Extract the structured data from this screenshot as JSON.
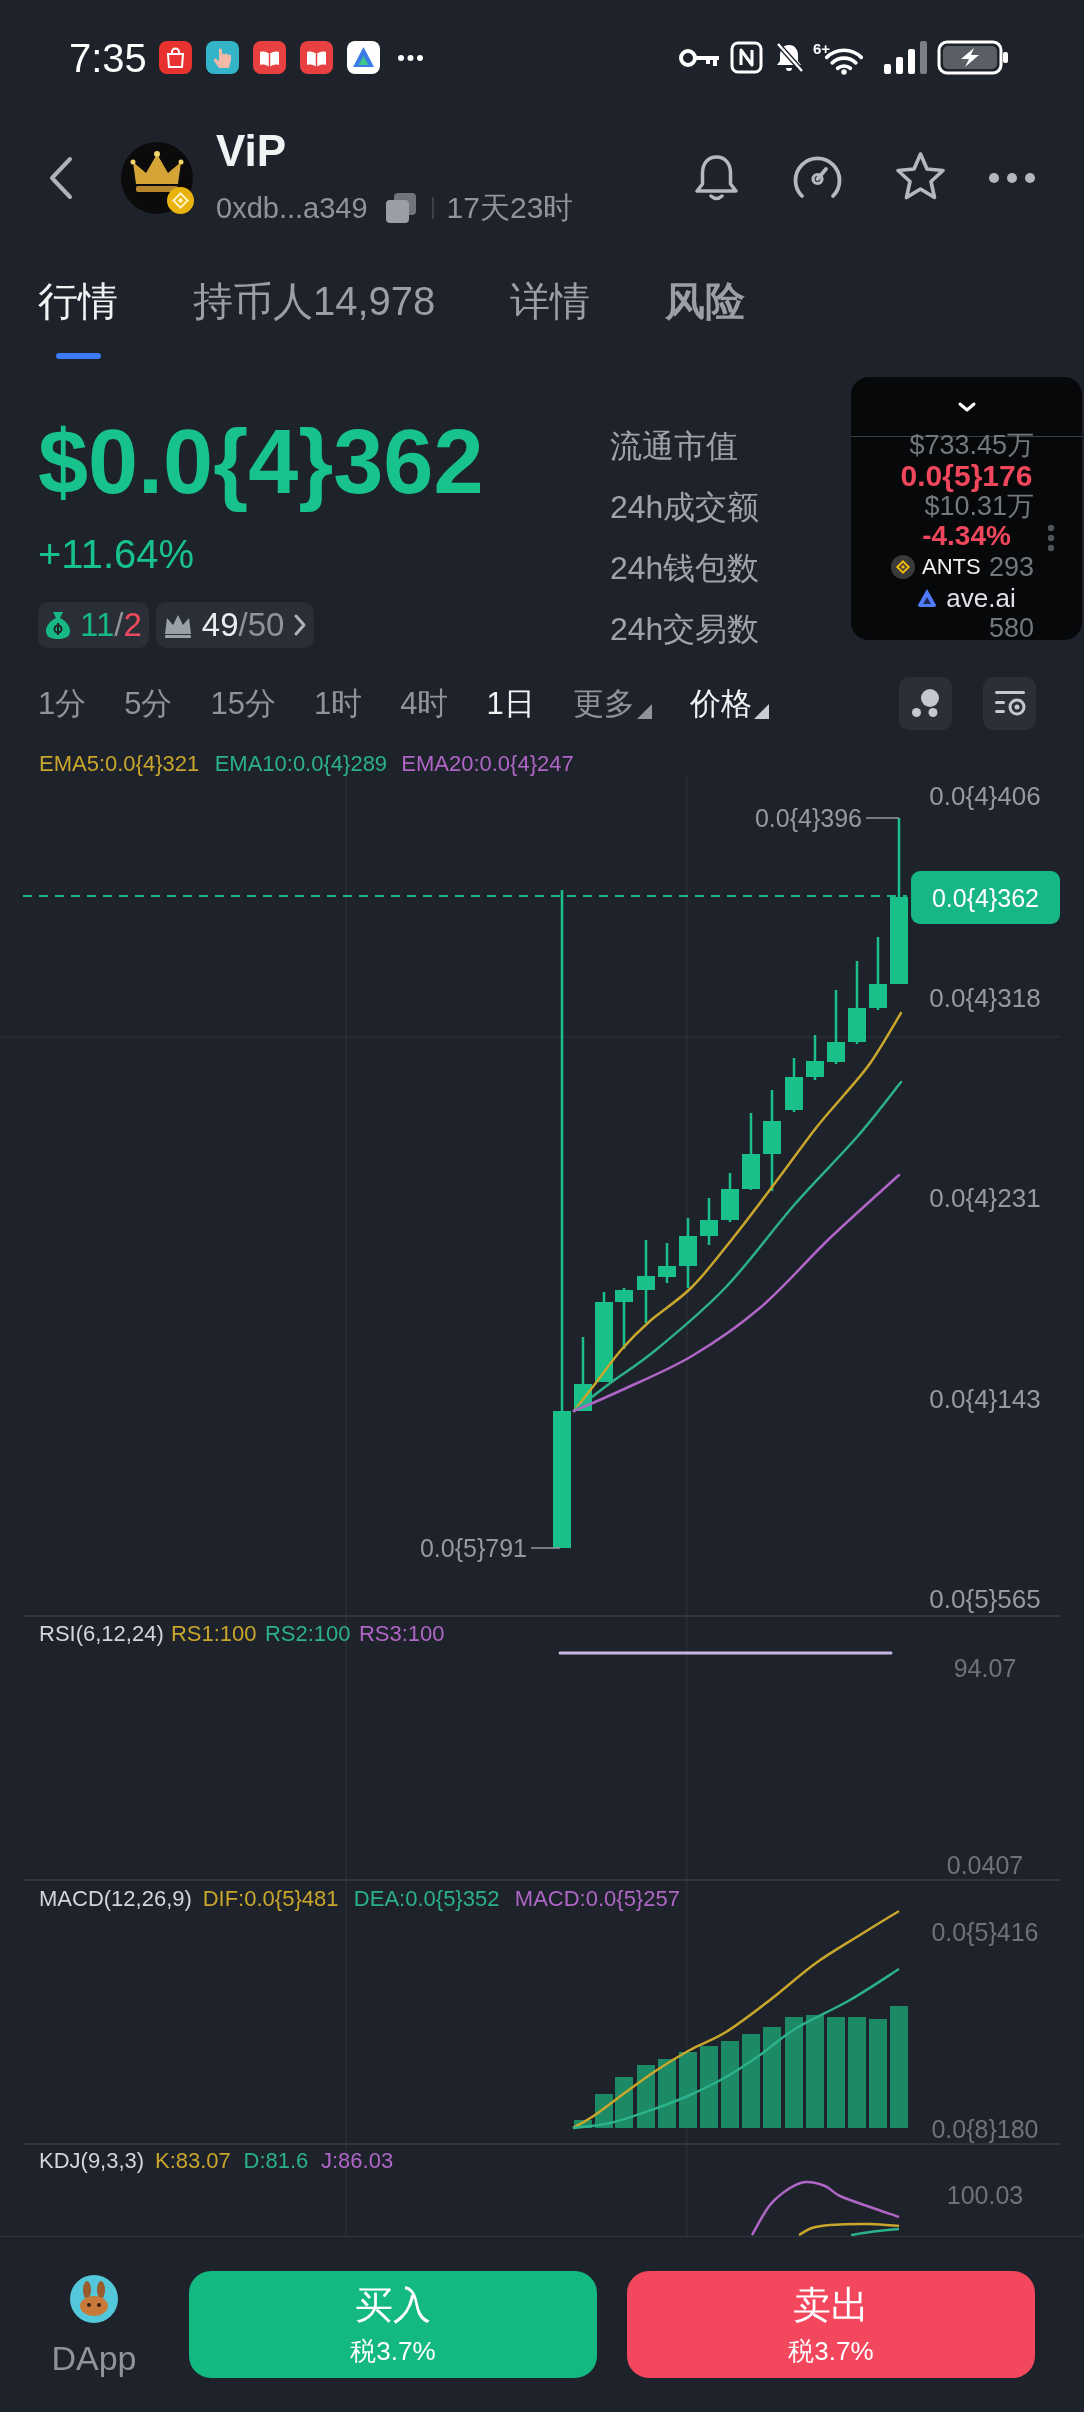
{
  "status_bar": {
    "time": "7:35",
    "wifi_badge": "6+"
  },
  "header": {
    "title": "ViP",
    "address": "0xdb...a349",
    "age": "17天23时"
  },
  "tabs": [
    {
      "label": "行情",
      "selected": true,
      "emphasized": false
    },
    {
      "label": "持币人14,978",
      "selected": false,
      "emphasized": false
    },
    {
      "label": "详情",
      "selected": false,
      "emphasized": false
    },
    {
      "label": "风险",
      "selected": false,
      "emphasized": true
    }
  ],
  "price": {
    "value": "$0.0{4}362",
    "change": "+11.64%",
    "negative": false,
    "badges": [
      {
        "kind": "money",
        "segments": [
          {
            "text": "11",
            "color": "#18b884"
          },
          {
            "text": "/",
            "color": "#8e939c"
          },
          {
            "text": "2",
            "color": "#f04a5e"
          }
        ],
        "chevron": false
      },
      {
        "kind": "top",
        "segments": [
          {
            "text": "49",
            "color": "#eceef1"
          },
          {
            "text": "/50",
            "color": "#8e939c"
          }
        ],
        "chevron": true
      }
    ]
  },
  "stats": [
    {
      "label": "流通市值",
      "value": "$733.45万"
    },
    {
      "label": "24h成交额",
      "value": "$10.31万"
    },
    {
      "label": "24h钱包数",
      "value": "293"
    },
    {
      "label": "24h交易数",
      "value": "580"
    }
  ],
  "floating_widget": {
    "price": "0.0{5}176",
    "change": "-4.34%",
    "negative": true,
    "token": "ANTS",
    "site": "ave.ai"
  },
  "chart_toolbar": {
    "timeframes": [
      {
        "label": "1分",
        "selected": false
      },
      {
        "label": "5分",
        "selected": false
      },
      {
        "label": "15分",
        "selected": false
      },
      {
        "label": "1时",
        "selected": false
      },
      {
        "label": "4时",
        "selected": false
      },
      {
        "label": "1日",
        "selected": true
      }
    ],
    "menus": [
      {
        "label": "更多",
        "active": false
      },
      {
        "label": "价格",
        "active": true
      }
    ]
  },
  "main_chart": {
    "legend": [
      {
        "label": "EMA5:0.0{4}321",
        "color": "#c9a62c"
      },
      {
        "label": "EMA10:0.0{4}289",
        "color": "#2bb18b"
      },
      {
        "label": "EMA20:0.0{4}247",
        "color": "#b066c6"
      }
    ],
    "y_labels": [
      "0.0{4}406",
      "0.0{4}318",
      "0.0{4}231",
      "0.0{4}143",
      "0.0{5}565"
    ],
    "current_price": "0.0{4}362",
    "high_label": "0.0{4}396",
    "low_label": "0.0{5}791"
  },
  "rsi": {
    "legend": [
      {
        "label": "RSI(6,12,24)",
        "color": "#d3d6db"
      },
      {
        "label": "RS1:100",
        "color": "#c9a62c"
      },
      {
        "label": "RS2:100",
        "color": "#2bb18b"
      },
      {
        "label": "RS3:100",
        "color": "#b066c6"
      }
    ],
    "y_labels": [
      "94.07",
      "0.0407"
    ]
  },
  "macd": {
    "legend": [
      {
        "label": "MACD(12,26,9)",
        "color": "#d3d6db"
      },
      {
        "label": "DIF:0.0{5}481",
        "color": "#c9a62c"
      },
      {
        "label": "DEA:0.0{5}352",
        "color": "#2bb18b"
      },
      {
        "label": "MACD:0.0{5}257",
        "color": "#b066c6"
      }
    ],
    "y_labels": [
      "0.0{5}416",
      "0.0{8}180"
    ]
  },
  "kdj": {
    "legend": [
      {
        "label": "KDJ(9,3,3)",
        "color": "#d3d6db"
      },
      {
        "label": "K:83.07",
        "color": "#c9a62c"
      },
      {
        "label": "D:81.6",
        "color": "#2bb18b"
      },
      {
        "label": "J:86.03",
        "color": "#b066c6"
      }
    ],
    "y_labels": [
      "100.03"
    ]
  },
  "bottom_bar": {
    "dapp_label": "DApp",
    "buttons": [
      {
        "kind": "buy",
        "label": "买入",
        "tax": "税3.7%"
      },
      {
        "kind": "sell",
        "label": "卖出",
        "tax": "税3.7%"
      }
    ]
  }
}
